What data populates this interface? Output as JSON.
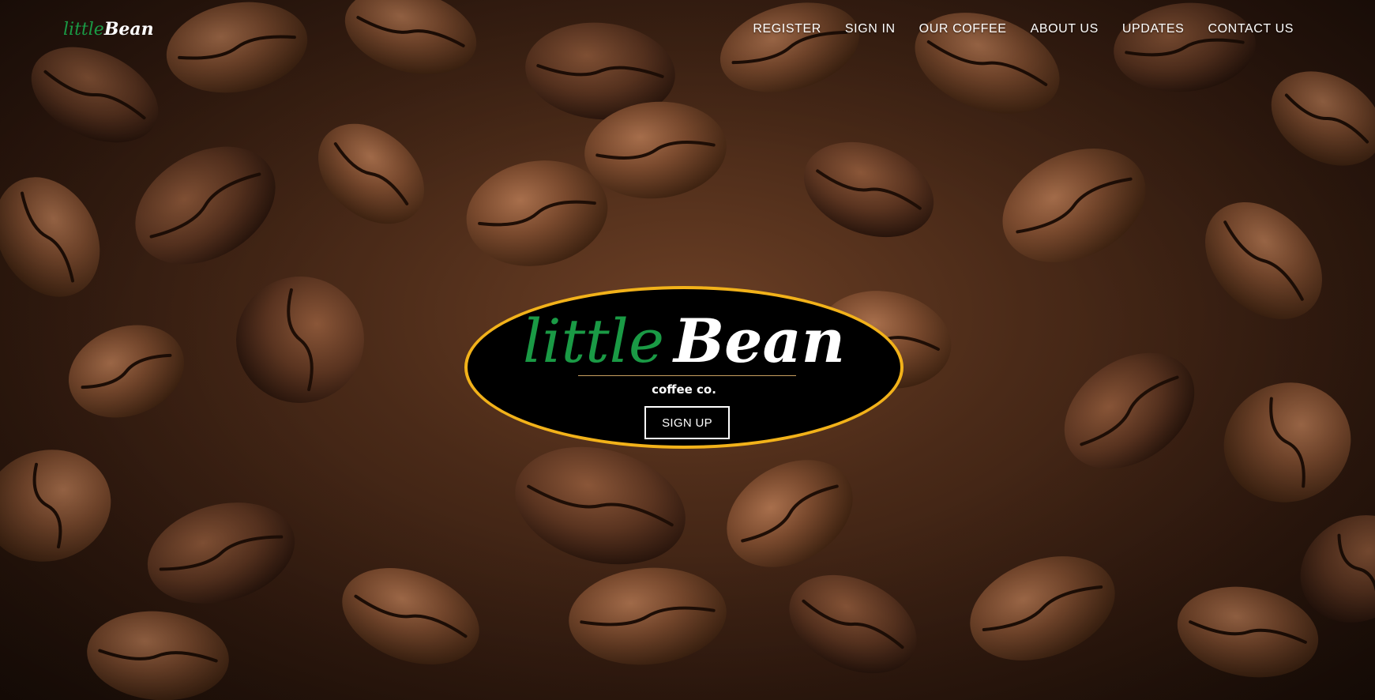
{
  "brand": {
    "little": "little",
    "bean": "Bean"
  },
  "nav": {
    "items": [
      {
        "label": "REGISTER"
      },
      {
        "label": "SIGN IN"
      },
      {
        "label": "OUR COFFEE"
      },
      {
        "label": "ABOUT US"
      },
      {
        "label": "UPDATES"
      },
      {
        "label": "CONTACT US"
      }
    ]
  },
  "hero": {
    "logo_little": "little",
    "logo_bean": "Bean",
    "tagline": "coffee co.",
    "signup_label": "SIGN UP",
    "background_image": "coffee-beans-photo"
  },
  "colors": {
    "brand_green": "#1a9a45",
    "oval_border": "#f2b21a",
    "oval_fill": "#000000",
    "text_white": "#ffffff"
  }
}
